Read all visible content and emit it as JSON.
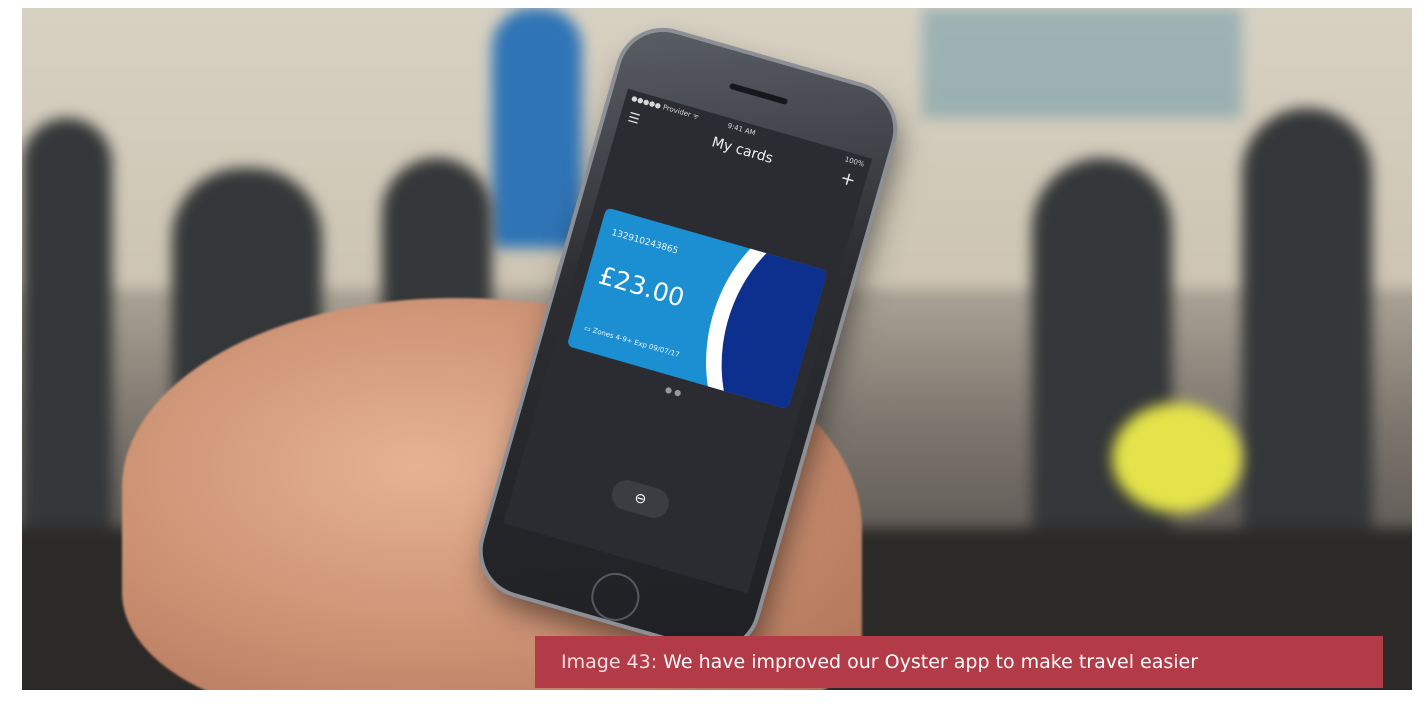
{
  "phone": {
    "status_left": "●●●●● Provider ᯤ",
    "status_time": "9:41 AM",
    "status_right": "100%",
    "title": "My cards",
    "menu_icon": "☰",
    "add_icon": "+",
    "card": {
      "number": "1329102438​65",
      "balance": "£23.00",
      "footer": "▭ Zones 4-9+   Exp 09/07/17"
    },
    "pager": "● ●",
    "tube_icon": "⊖"
  },
  "caption": {
    "label": "Image 43:",
    "text": "We have improved our Oyster app to make travel easier"
  },
  "colors": {
    "caption_bg": "#b23b47",
    "card_blue": "#1b8fd1",
    "card_navy": "#0d2f8e",
    "screen_bg": "#2b2c31"
  }
}
